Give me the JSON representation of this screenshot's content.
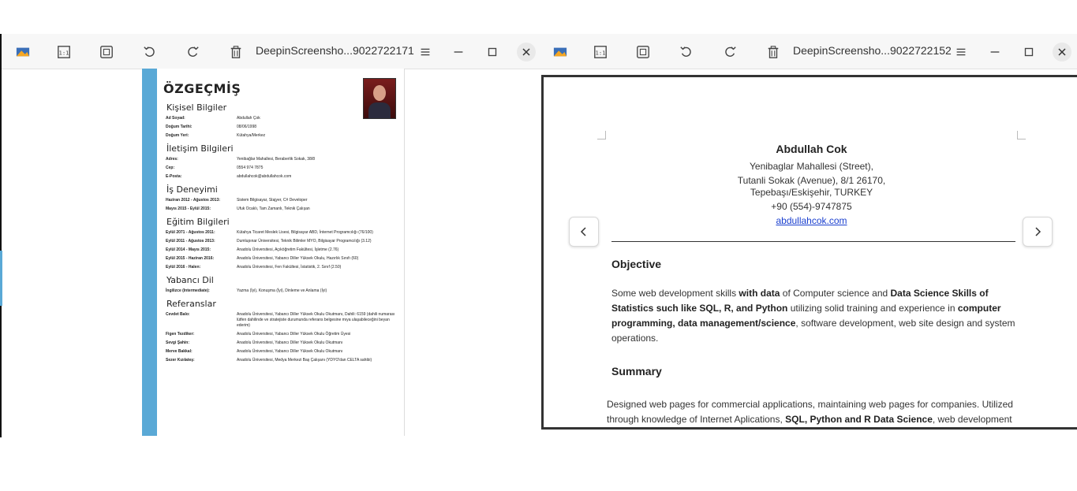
{
  "left_window": {
    "title": "DeepinScreensho...9022722171",
    "cv": {
      "title": "ÖZGEÇMİŞ",
      "sections": [
        {
          "heading": "Kişisel Bilgiler",
          "rows": [
            {
              "k": "Ad Soyad:",
              "v": "Abdullah Çok"
            },
            {
              "k": "Doğum Tarihi:",
              "v": "08/06/1998"
            },
            {
              "k": "Doğum Yeri:",
              "v": "Kütahya/Merkez"
            }
          ]
        },
        {
          "heading": "İletişim Bilgileri",
          "rows": [
            {
              "k": "Adres:",
              "v": "Yenibağlar Mahallesi, Beraberlik Sokak, 38/8"
            },
            {
              "k": "Cep:",
              "v": "0554 974 7875"
            },
            {
              "k": "E-Posta:",
              "v": "abdullahcok@abdullahcok.com"
            }
          ]
        },
        {
          "heading": "İş Deneyimi",
          "rows": [
            {
              "k": "Haziran 2012 - Ağustos 2013:",
              "v": "Sistem Bilgisayar, Stajyer, C# Developer"
            },
            {
              "k": "Mayıs 2015 - Eylül 2015:",
              "v": "Ufuk Ocaklı, Tam Zamanlı, Teknik Çalışan"
            }
          ]
        },
        {
          "heading": "Eğitim Bilgileri",
          "rows": [
            {
              "k": "Eylül 2071 - Ağustos 2011:",
              "v": "Kütahya Ticaret Meslek Lisesi, Bilgisayar ABD, İnternet Programcılığı (76/100)"
            },
            {
              "k": "Eylül 2011 - Ağustos 2013:",
              "v": "Dumlupınar Üniversitesi, Teknik Bilimler MYO, Bilgisayar Programcılığı (3.12)"
            },
            {
              "k": "Eylül 2014 - Mayıs 2015:",
              "v": "Anadolu Üniversitesi, Açıköğretim Fakültesi, İşletme (2.76)"
            },
            {
              "k": "Eylül 2015 - Haziran 2016:",
              "v": "Anadolu Üniversitesi, Yabancı Diller Yüksek Okulu, Hazırlık Sınıfı (60)"
            },
            {
              "k": "Eylül 2016 - Halen:",
              "v": "Anadolu Üniversitesi, Fen Fakültesi, İstatistik, 2. Sınıf (2.50)"
            }
          ]
        },
        {
          "heading": "Yabancı Dil",
          "rows": [
            {
              "k": "İngilizce (Intermediate):",
              "v": "Yazma (İyi), Konuşma (İyi), Dinleme ve Anlama (İyi)"
            }
          ]
        },
        {
          "heading": "Referanslar",
          "rows": [
            {
              "k": "Cevdet Balo:",
              "v": "Anadolu Üniversitesi, Yabancı Diller Yüksek Okulu Okutmanı, Dahili: 6159 (dahili numarası lütfen dahilinde ve stratejiste durumunda referans belgesine mıya ulaşabileceğini beyan ederim)"
            },
            {
              "k": "Figen Tezdiker:",
              "v": "Anadolu Üniversitesi, Yabancı Diller Yüksek Okulu Öğretim Üyesi"
            },
            {
              "k": "Sevgi Şahin:",
              "v": "Anadolu Üniversitesi, Yabancı Diller Yüksek Okulu Okutmanı"
            },
            {
              "k": "Merve Bakkal:",
              "v": "Anadolu Üniversitesi, Yabancı Diller Yüksek Okulu Okutmanı"
            },
            {
              "k": "Sezer Kızılateş:",
              "v": "Anadolu Üniversitesi, Medya Merkezi Baş Çalışanı (YDYO'dan CELTA sahibi)"
            }
          ]
        }
      ]
    }
  },
  "right_window": {
    "title": "DeepinScreensho...9022722152",
    "resume": {
      "name": "Abdullah Cok",
      "address_1": "Yenibaglar Mahallesi (Street),",
      "address_2": "Tutanli Sokak (Avenue), 8/1 26170,",
      "address_3": "Tepebaşı/Eskişehir, TURKEY",
      "phone": "+90 (554)-9747875",
      "email": "abdullahcok.com",
      "objective_heading": "Objective",
      "objective_text": {
        "p1": "Some web development skills ",
        "b1": "with data",
        "p2": " of Computer science and ",
        "b2": "Data Science Skills of Statistics such like SQL, R, and Python",
        "p3": " utilizing solid training and experience in ",
        "b3": "computer programming, data management/science",
        "p4": ", software development, web site design and system operations."
      },
      "summary_heading": "Summary",
      "summary_text": {
        "p1": "Designed web pages for commercial applications, maintaining web pages for companies. Utilized through knowledge of Internet Aplications, ",
        "b1": "SQL, Python and R Data Science",
        "p2": ", web development"
      }
    }
  },
  "toolbar_icons": [
    "image-icon",
    "fit-size-icon",
    "fullscreen-icon",
    "rotate-left-icon",
    "rotate-right-icon",
    "trash-icon",
    "menu-icon",
    "minimize-icon",
    "maximize-icon",
    "close-icon"
  ],
  "colors": {
    "cv_bar": "#5aa9d6",
    "link": "#1a3fcf"
  }
}
